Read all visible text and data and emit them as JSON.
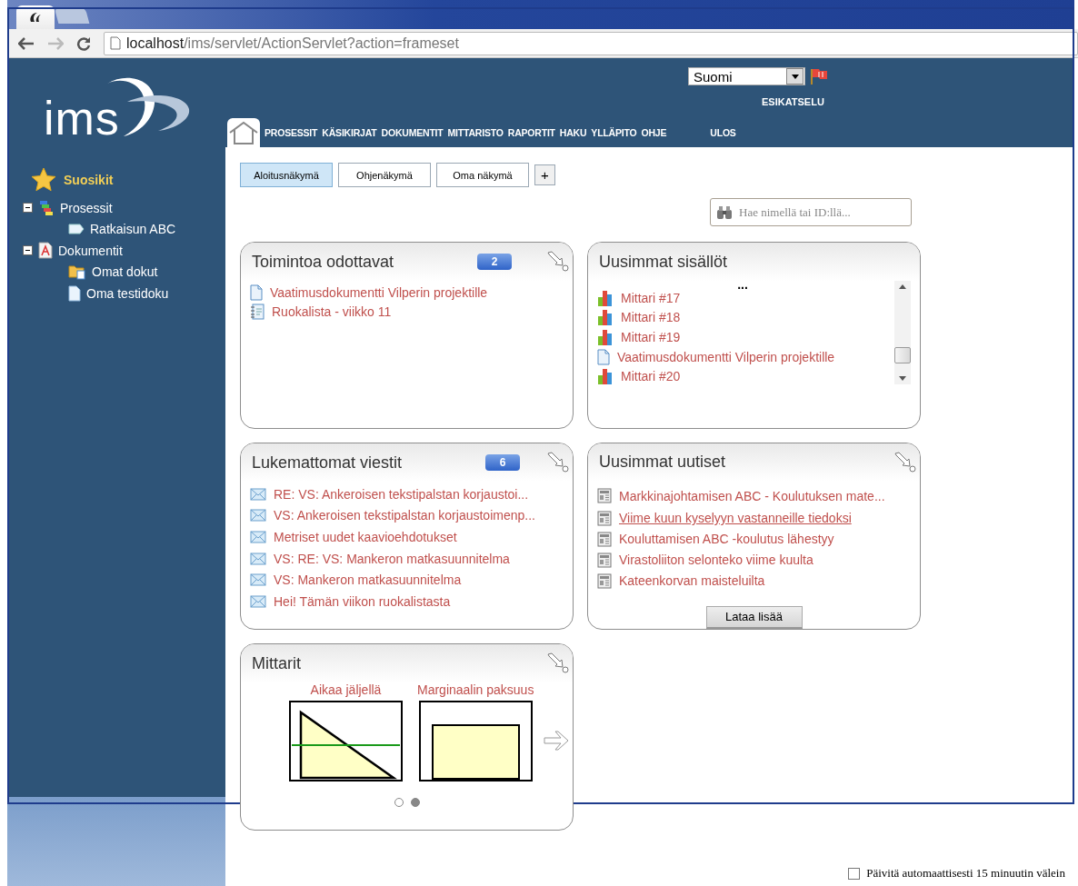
{
  "browser": {
    "tabs": [
      {
        "kind": "page",
        "selected": true
      },
      {
        "kind": "new",
        "selected": false
      }
    ],
    "address_bar": {
      "host": "localhost",
      "path": "/ims/servlet/ActionServlet?action=frameset"
    }
  },
  "logo": {
    "text": "ims"
  },
  "language": {
    "value": "Suomi"
  },
  "preview_link": "ESIKATSELU",
  "logout_link": "ULOS",
  "nav": [
    {
      "kind": "home",
      "selected": true
    },
    {
      "kind": "text",
      "label": "PROSESSIT",
      "selected": false
    },
    {
      "kind": "text",
      "label": "KÄSIKIRJAT",
      "selected": false
    },
    {
      "kind": "text",
      "label": "DOKUMENTIT",
      "selected": false
    },
    {
      "kind": "text",
      "label": "MITTARISTO",
      "selected": false
    },
    {
      "kind": "text",
      "label": "RAPORTIT",
      "selected": false
    },
    {
      "kind": "text",
      "label": "HAKU",
      "selected": false
    },
    {
      "kind": "text",
      "label": "YLLÄPITO",
      "selected": false
    },
    {
      "kind": "text",
      "label": "OHJE",
      "selected": false
    }
  ],
  "sidebar": {
    "title": "Suosikit",
    "tree": [
      {
        "label": "Prosessit",
        "kind": "process",
        "expanded": true,
        "children": [
          {
            "label": "Ratkaisun ABC",
            "kind": "process-item"
          }
        ]
      },
      {
        "label": "Dokumentit",
        "kind": "documents",
        "expanded": true,
        "children": [
          {
            "label": "Omat dokut",
            "kind": "folder"
          },
          {
            "label": "Oma testidoku",
            "kind": "document"
          }
        ]
      }
    ]
  },
  "view_tabs": [
    {
      "label": "Aloitusnäkymä",
      "selected": true
    },
    {
      "label": "Ohjenäkymä",
      "selected": false
    },
    {
      "label": "Oma näkymä",
      "selected": false
    }
  ],
  "add_view": "+",
  "search": {
    "placeholder": "Hae nimellä tai ID:llä..."
  },
  "cards": [
    {
      "kind": "list",
      "title": "Toimintoa odottavat",
      "badge": "2",
      "expandable": true,
      "items": [
        {
          "kind": "document",
          "label": "Vaatimusdokumentti Vilperin projektille"
        },
        {
          "kind": "notebook",
          "label": "Ruokalista - viikko 11"
        }
      ]
    },
    {
      "kind": "scroll-list",
      "title": "Uusimmat sisällöt",
      "expandable": false,
      "more": "...",
      "items": [
        {
          "kind": "gauge",
          "label": "Mittari #17"
        },
        {
          "kind": "gauge",
          "label": "Mittari #18"
        },
        {
          "kind": "gauge",
          "label": "Mittari #19"
        },
        {
          "kind": "document",
          "label": "Vaatimusdokumentti Vilperin projektille"
        },
        {
          "kind": "gauge",
          "label": "Mittari #20"
        }
      ]
    },
    {
      "kind": "list",
      "title": "Lukemattomat viestit",
      "badge": "6",
      "expandable": true,
      "items": [
        {
          "kind": "envelope",
          "label": "RE: VS: Ankeroisen tekstipalstan korjaustoi..."
        },
        {
          "kind": "envelope",
          "label": "VS: Ankeroisen tekstipalstan korjaustoimenp..."
        },
        {
          "kind": "envelope",
          "label": "Metriset uudet kaavioehdotukset"
        },
        {
          "kind": "envelope",
          "label": "VS: RE: VS: Mankeron matkasuunnitelma"
        },
        {
          "kind": "envelope",
          "label": "VS: Mankeron matkasuunnitelma"
        },
        {
          "kind": "envelope",
          "label": "Hei! Tämän viikon ruokalistasta"
        }
      ]
    },
    {
      "kind": "news",
      "title": "Uusimmat uutiset",
      "expandable": true,
      "button": "Lataa lisää",
      "items": [
        {
          "kind": "news",
          "label": "Markkinajohtamisen ABC - Koulutuksen mate...",
          "underlined": false
        },
        {
          "kind": "news",
          "label": "Viime kuun kyselyyn vastanneille tiedoksi",
          "underlined": true
        },
        {
          "kind": "news",
          "label": "Kouluttamisen ABC -koulutus lähestyy",
          "underlined": false
        },
        {
          "kind": "news",
          "label": "Virastoliiton selonteko viime kuulta",
          "underlined": false
        },
        {
          "kind": "news",
          "label": "Kateenkorvan maisteluilta",
          "underlined": false
        }
      ]
    },
    {
      "kind": "gauges",
      "title": "Mittarit",
      "expandable": true,
      "gauges": [
        {
          "title": "Aikaa jäljellä",
          "kind": "triangle"
        },
        {
          "title": "Marginaalin paksuus",
          "kind": "rectangle"
        }
      ],
      "pages": [
        {
          "selected": false
        },
        {
          "selected": true
        }
      ]
    }
  ],
  "auto_refresh": {
    "label": "Päivitä automaattisesti 15 minuutin välein",
    "checked": false
  }
}
